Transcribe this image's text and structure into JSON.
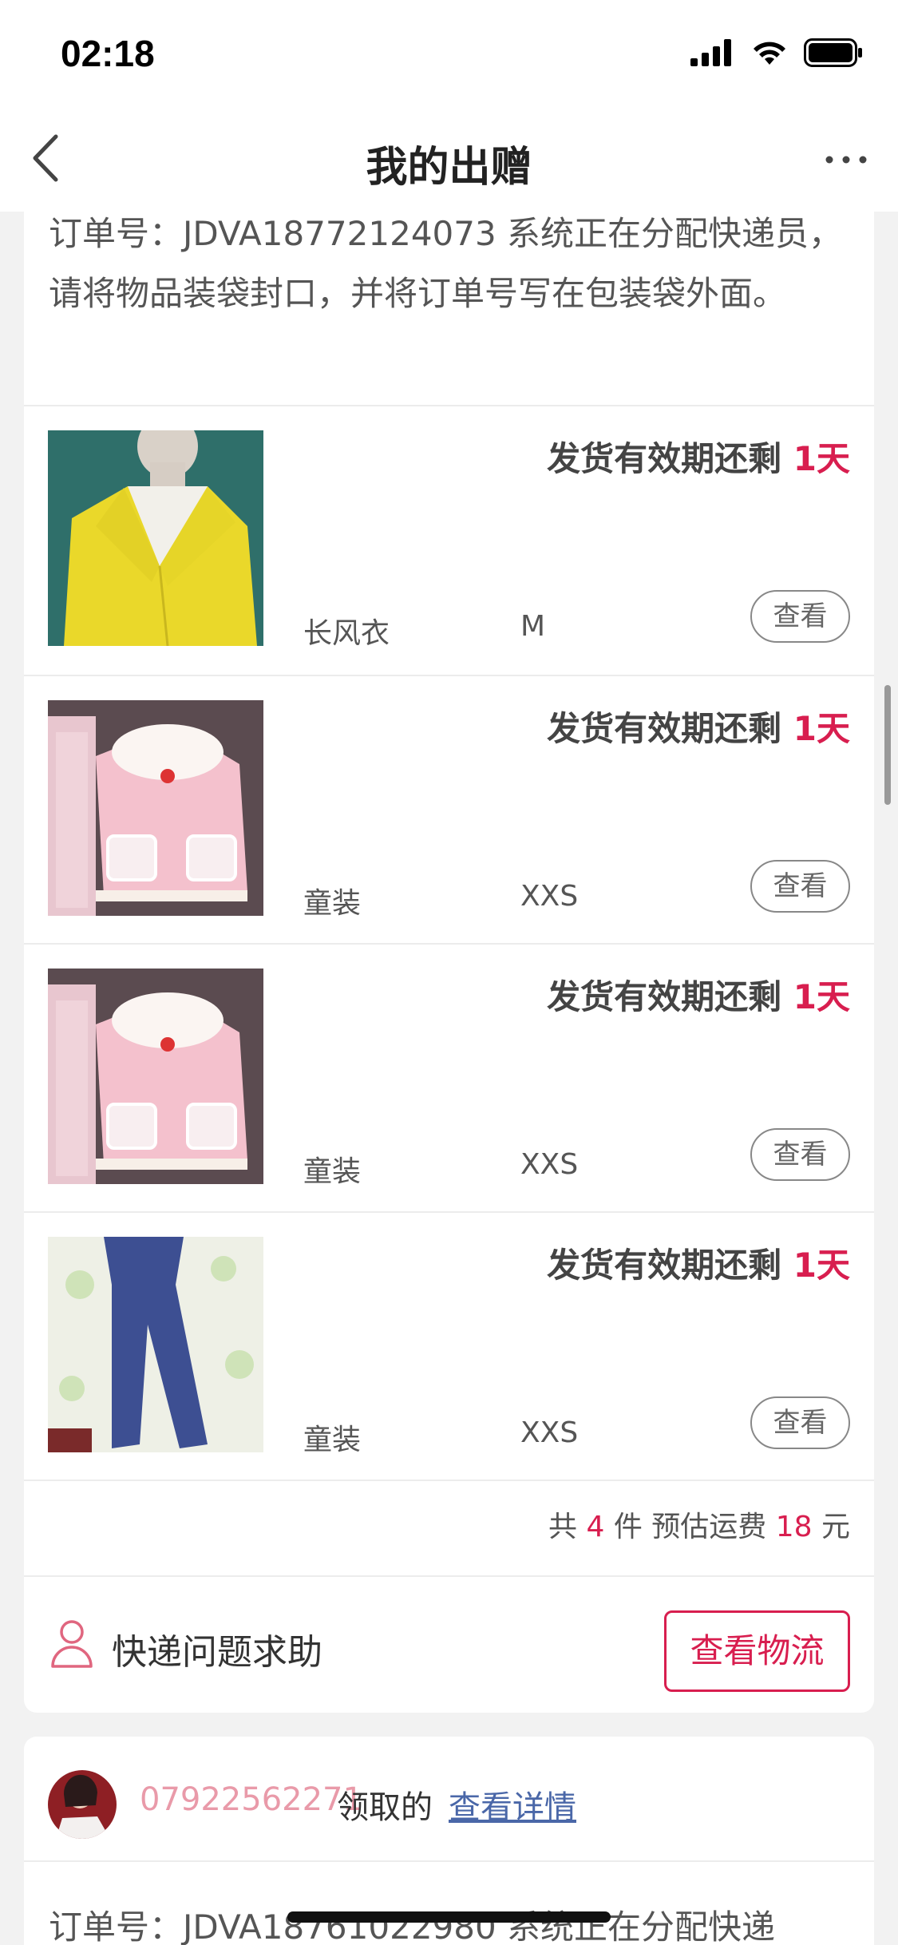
{
  "status_bar": {
    "time": "02:18"
  },
  "nav": {
    "title": "我的出赠"
  },
  "order1": {
    "text": "订单号：JDVA18772124073 系统正在分配快递员，请将物品装袋封口，并将订单号写在包装袋外面。"
  },
  "items": [
    {
      "deadline_prefix": "发货有效期还剩 ",
      "deadline_value": "1天",
      "name": "长风衣",
      "size": "M",
      "view_label": "查看"
    },
    {
      "deadline_prefix": "发货有效期还剩 ",
      "deadline_value": "1天",
      "name": "童装",
      "size": "XXS",
      "view_label": "查看"
    },
    {
      "deadline_prefix": "发货有效期还剩 ",
      "deadline_value": "1天",
      "name": "童装",
      "size": "XXS",
      "view_label": "查看"
    },
    {
      "deadline_prefix": "发货有效期还剩 ",
      "deadline_value": "1天",
      "name": "童装",
      "size": "XXS",
      "view_label": "查看"
    }
  ],
  "summary": {
    "prefix": "共 ",
    "count": "4",
    "middle": " 件 预估运费 ",
    "fee": "18",
    "suffix": " 元"
  },
  "help": {
    "label": "快递问题求助",
    "logistics_button": "查看物流"
  },
  "order2": {
    "phone": "07922562271",
    "claimed": "领取的",
    "detail_link": "查看详情",
    "text": "订单号：JDVA18761022980 系统正在分配快递"
  },
  "colors": {
    "accent": "#d81e4f",
    "phone": "#e99aa9",
    "link": "#4a67a8"
  }
}
